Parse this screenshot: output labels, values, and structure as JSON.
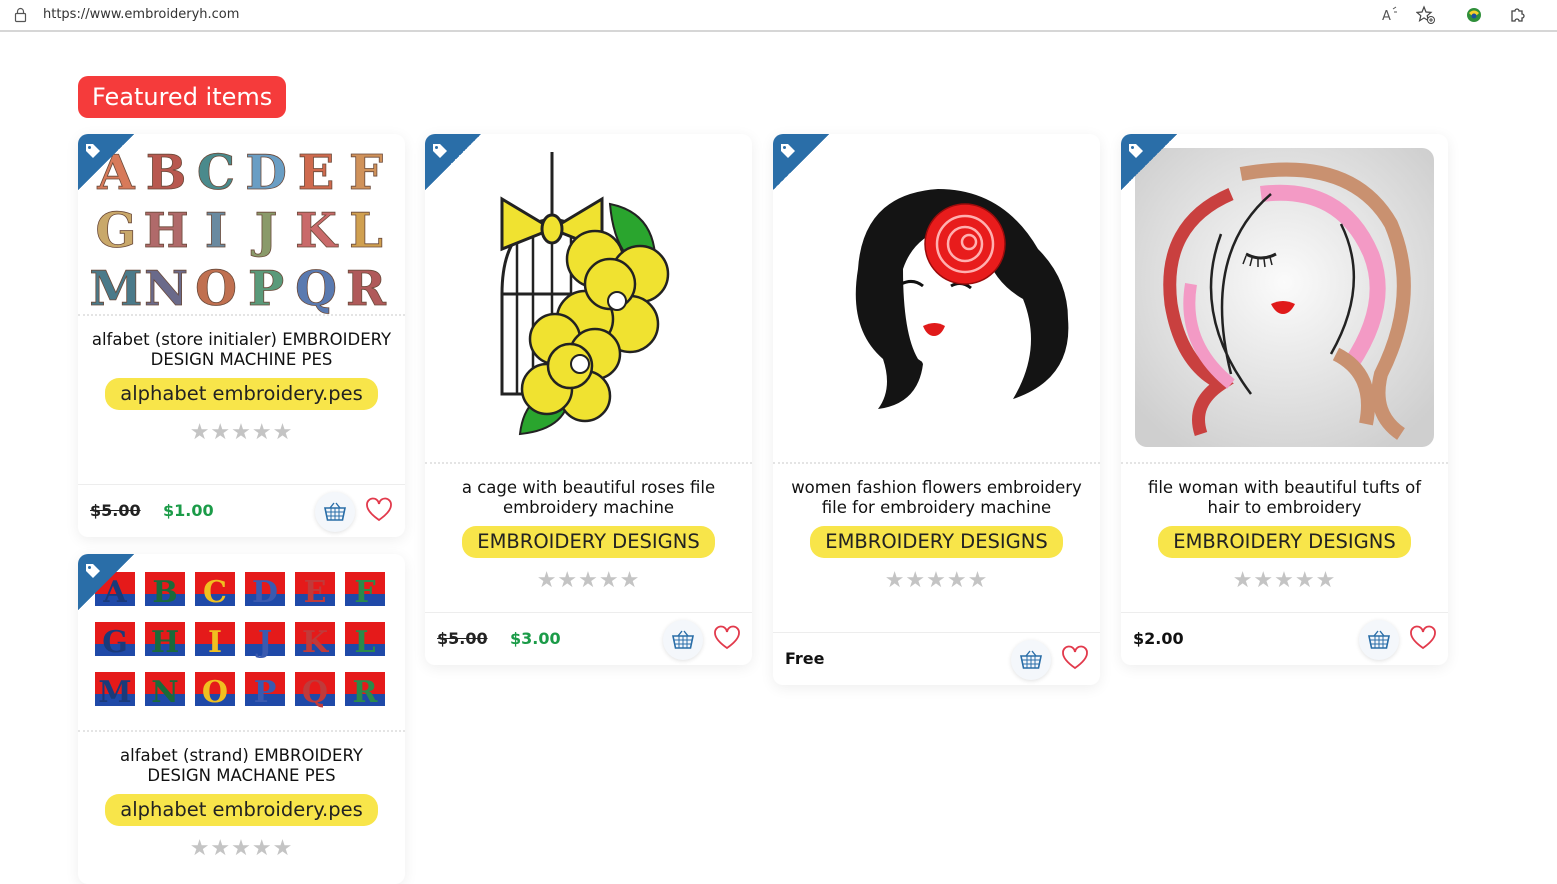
{
  "browser": {
    "url": "https://www.embroideryh.com"
  },
  "section": {
    "title": "Featured items"
  },
  "products": [
    {
      "title": "alfabet (store initialer) EMBROIDERY DESIGN MACHINE PES",
      "category": "alphabet embroidery.pes",
      "rating": 0,
      "old_price": "$5.00",
      "price": "$1.00",
      "letters": [
        "A",
        "B",
        "C",
        "D",
        "E",
        "F",
        "G",
        "H",
        "I",
        "J",
        "K",
        "L",
        "M",
        "N",
        "O",
        "P",
        "Q",
        "R"
      ]
    },
    {
      "title": "a cage with beautiful roses file embroidery machine",
      "category": "EMBROIDERY DESIGNS",
      "rating": 0,
      "old_price": "$5.00",
      "price": "$3.00"
    },
    {
      "title": "women fashion flowers embroidery file for embroidery machine",
      "category": "EMBROIDERY DESIGNS",
      "rating": 0,
      "price": "Free"
    },
    {
      "title": "file woman with beautiful tufts of hair to embroidery",
      "category": "EMBROIDERY DESIGNS",
      "rating": 0,
      "price": "$2.00"
    },
    {
      "title": "alfabet (strand) EMBROIDERY DESIGN MACHANE PES",
      "category": "alphabet embroidery.pes",
      "rating": 0,
      "letters": [
        "A",
        "B",
        "C",
        "D",
        "E",
        "F",
        "G",
        "H",
        "I",
        "J",
        "K",
        "L",
        "M",
        "N",
        "O",
        "P",
        "Q",
        "R"
      ]
    }
  ],
  "colors": {
    "badge": "#f53b3b",
    "category_pill": "#f8e54a",
    "tag_corner": "#2a6ea8",
    "sale_price": "#1b9b48",
    "heart": "#e23a4c",
    "cart": "#2a6ea8"
  },
  "icons": {
    "lock": "lock-icon",
    "read_aloud": "read-aloud-icon",
    "favorites": "add-favorite-icon",
    "extension": "extension-icon",
    "puzzle": "puzzle-icon",
    "tag": "tag-icon",
    "cart": "basket-icon",
    "wishlist": "heart-icon",
    "star": "star-icon"
  }
}
